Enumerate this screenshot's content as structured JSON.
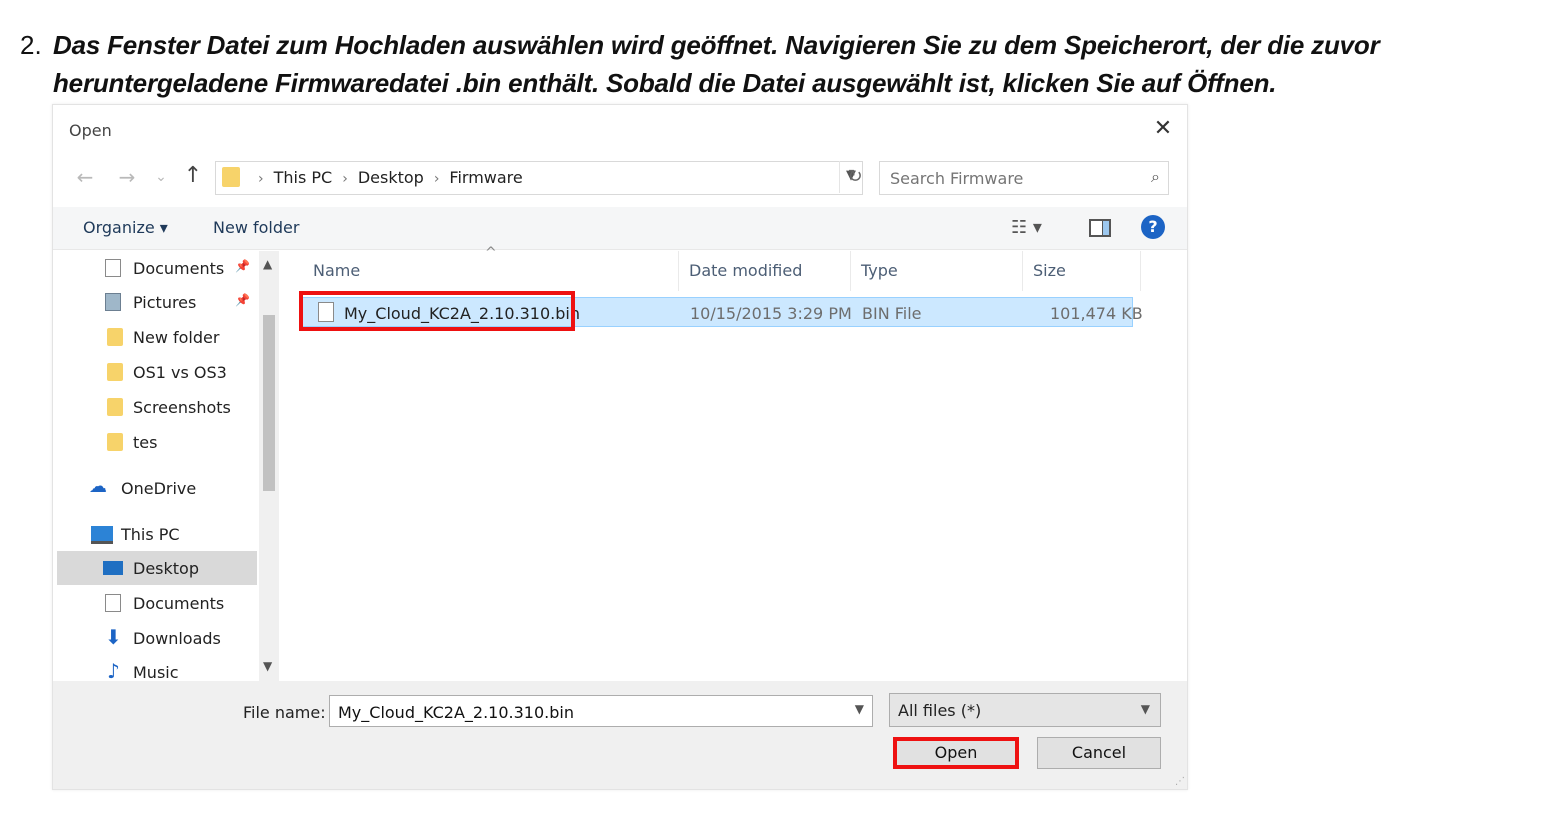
{
  "instruction": {
    "number": "2.",
    "text": "Das Fenster Datei zum Hochladen auswählen wird geöffnet. Navigieren Sie zu dem Speicherort, der die zuvor heruntergeladene Firmwaredatei .bin enthält. Sobald die Datei ausgewählt ist, klicken Sie auf Öffnen."
  },
  "dialog": {
    "title": "Open",
    "close_glyph": "✕",
    "nav": {
      "back": "←",
      "forward": "→",
      "recent": "⌄",
      "up": "↑"
    },
    "breadcrumb": [
      "This PC",
      "Desktop",
      "Firmware"
    ],
    "breadcrumb_sep": "›",
    "refresh_glyph": "↻",
    "search_placeholder": "Search Firmware",
    "toolbar": {
      "organize": "Organize ▾",
      "new_folder": "New folder",
      "view_glyph": "☷ ▾",
      "help": "?"
    },
    "sidebar": {
      "items": [
        {
          "label": "Documents",
          "icon": "documents-icon"
        },
        {
          "label": "Pictures",
          "icon": "pictures-icon"
        },
        {
          "label": "New folder",
          "icon": "folder-icon"
        },
        {
          "label": "OS1 vs OS3",
          "icon": "folder-icon"
        },
        {
          "label": "Screenshots",
          "icon": "folder-icon"
        },
        {
          "label": "tes",
          "icon": "folder-icon"
        },
        {
          "label": "OneDrive",
          "icon": "onedrive-icon"
        },
        {
          "label": "This PC",
          "icon": "this-pc-icon"
        },
        {
          "label": "Desktop",
          "icon": "desktop-icon"
        },
        {
          "label": "Documents",
          "icon": "documents-icon"
        },
        {
          "label": "Downloads",
          "icon": "downloads-icon"
        },
        {
          "label": "Music",
          "icon": "music-icon"
        }
      ],
      "selected": "Desktop",
      "pin_glyph": "📌"
    },
    "columns": {
      "name": "Name",
      "date_modified": "Date modified",
      "type": "Type",
      "size": "Size"
    },
    "files": [
      {
        "name": "My_Cloud_KC2A_2.10.310.bin",
        "date_modified": "10/15/2015 3:29 PM",
        "type": "BIN File",
        "size": "101,474 KB"
      }
    ],
    "footer": {
      "file_name_label": "File name:",
      "file_name_value": "My_Cloud_KC2A_2.10.310.bin",
      "file_type": "All files (*)",
      "open": "Open",
      "cancel": "Cancel"
    }
  },
  "colors": {
    "highlight": "#ee1111",
    "selection": "#cce8ff",
    "accent": "#1c64c5"
  }
}
